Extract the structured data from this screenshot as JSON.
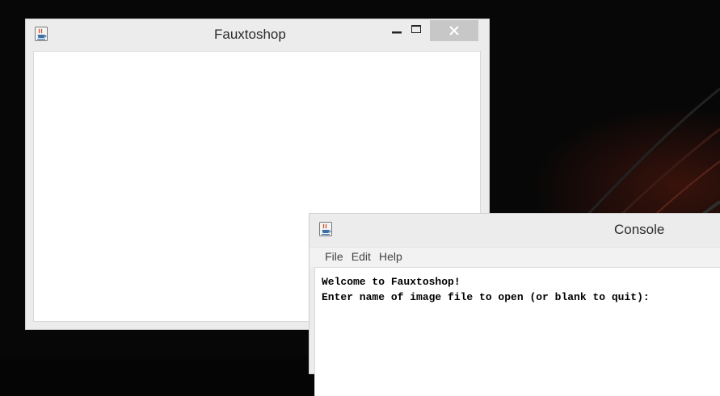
{
  "desktop": {
    "background_color": "#070707",
    "accent_color": "#8a2a1a"
  },
  "main_window": {
    "title": "Fauxtoshop",
    "icon": "java-cup-icon",
    "controls": {
      "minimize_icon": "minimize-icon",
      "maximize_icon": "maximize-icon",
      "close_icon": "close-icon"
    }
  },
  "console_window": {
    "title": "Console",
    "icon": "java-cup-icon",
    "menu": [
      {
        "label": "File"
      },
      {
        "label": "Edit"
      },
      {
        "label": "Help"
      }
    ],
    "lines": [
      "Welcome to Fauxtoshop!",
      "Enter name of image file to open (or blank to quit):"
    ]
  }
}
